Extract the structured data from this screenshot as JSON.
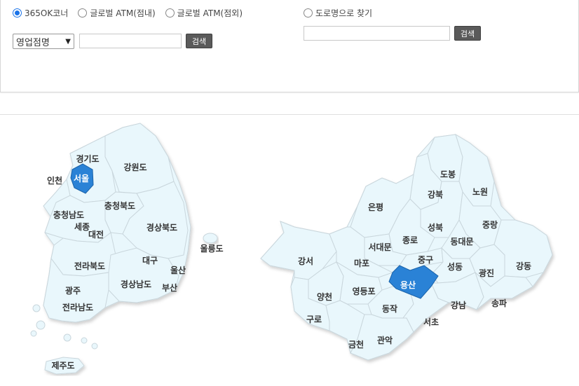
{
  "search": {
    "radios": [
      {
        "label": "365OK코너",
        "checked": true
      },
      {
        "label": "글로벌 ATM(점내)",
        "checked": false
      },
      {
        "label": "글로벌 ATM(점외)",
        "checked": false
      }
    ],
    "road_radio": {
      "label": "도로명으로 찾기",
      "checked": false
    },
    "select_value": "영업점명",
    "search_button": "검색",
    "road_search_button": "검색"
  },
  "korea_map": {
    "regions": [
      "경기도",
      "강원도",
      "인천",
      "서울",
      "충청북도",
      "충청남도",
      "세종",
      "대전",
      "경상북도",
      "울릉도",
      "전라북도",
      "대구",
      "울산",
      "경상남도",
      "부산",
      "광주",
      "전라남도",
      "제주도"
    ],
    "selected": "서울"
  },
  "seoul_map": {
    "districts": [
      "도봉",
      "강북",
      "노원",
      "은평",
      "성북",
      "중랑",
      "종로",
      "동대문",
      "서대문",
      "강서",
      "마포",
      "중구",
      "성동",
      "광진",
      "강동",
      "용산",
      "양천",
      "영등포",
      "동작",
      "강남",
      "송파",
      "구로",
      "서초",
      "금천",
      "관악"
    ],
    "selected": "용산"
  },
  "colors": {
    "selected": "#2a82d6",
    "region_fill": "#e9f7fc",
    "region_stroke": "#c9d6dc",
    "button": "#5a5a5a"
  }
}
